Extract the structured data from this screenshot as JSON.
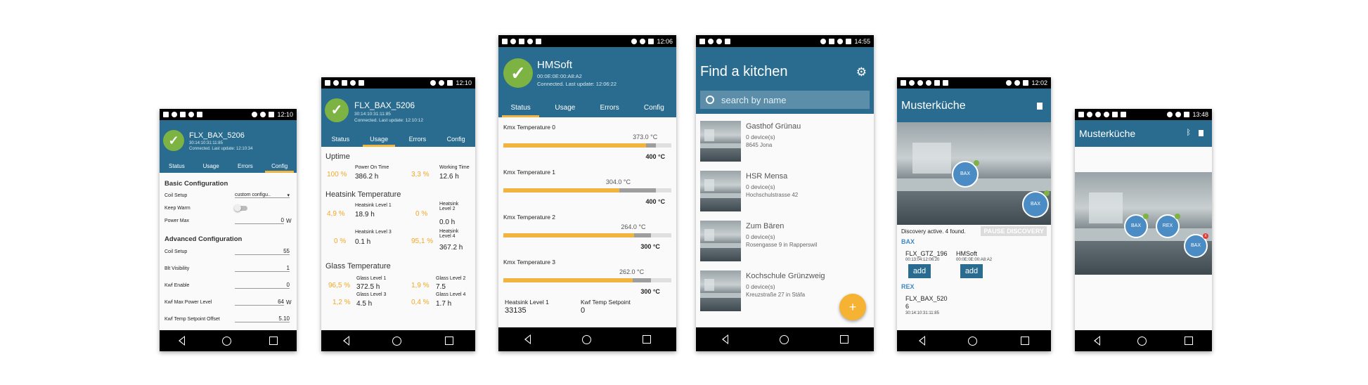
{
  "screens": {
    "s1": {
      "status_time": "12:10",
      "device_name": "FLX_BAX_5206",
      "device_mac": "30:14:10:31:11:85",
      "device_status": "Connected. Last update: 12:10:34",
      "tabs": [
        "Status",
        "Usage",
        "Errors",
        "Config"
      ],
      "basic_title": "Basic Configuration",
      "basic": [
        {
          "label": "Coil Setup",
          "value": "custom configu..",
          "kind": "dropdown"
        },
        {
          "label": "Keep Warm",
          "value": "",
          "kind": "toggle"
        },
        {
          "label": "Power Max",
          "value": "0",
          "unit": "W",
          "kind": "input"
        }
      ],
      "adv_title": "Advanced Configuration",
      "advanced": [
        {
          "label": "Coil Setup",
          "value": "55",
          "unit": ""
        },
        {
          "label": "Blt Visibility",
          "value": "1",
          "unit": ""
        },
        {
          "label": "Kwf Enable",
          "value": "0",
          "unit": ""
        },
        {
          "label": "Kwf Max Power Level",
          "value": "64",
          "unit": "W"
        },
        {
          "label": "Kwf Temp Setpoint Offset",
          "value": "5.10",
          "unit": ""
        }
      ]
    },
    "s2": {
      "status_time": "12:10",
      "device_name": "FLX_BAX_5206",
      "device_mac": "30:14:10:31:11:85",
      "device_status": "Connected. Last update: 12:10:12",
      "tabs": [
        "Status",
        "Usage",
        "Errors",
        "Config"
      ],
      "uptime_title": "Uptime",
      "uptime": [
        {
          "pct": "100 %",
          "label": "Power On Time",
          "value": "386.2 h"
        },
        {
          "pct": "3,3 %",
          "label": "Working Time",
          "value": "12.6 h"
        }
      ],
      "heatsink_title": "Heatsink Temperature",
      "heatsink": [
        {
          "pct": "4,9 %",
          "label": "Heatsink Level 1",
          "value": "18.9 h"
        },
        {
          "pct": "0 %",
          "label": "Heatsink Level 2",
          "value": "0.0 h"
        },
        {
          "pct": "0 %",
          "label": "Heatsink Level 3",
          "value": "0.1 h"
        },
        {
          "pct": "95,1 %",
          "label": "Heatsink Level 4",
          "value": "367.2 h"
        }
      ],
      "glass_title": "Glass Temperature",
      "glass": [
        {
          "pct": "96,5 %",
          "label": "Glass Level 1",
          "value": "372.5 h"
        },
        {
          "pct": "1,9 %",
          "label": "Glass Level 2",
          "value": "7.5"
        },
        {
          "pct": "1,2 %",
          "label": "Glass Level 3",
          "value": "4.5 h"
        },
        {
          "pct": "0,4 %",
          "label": "Glass Level 4",
          "value": "1.7 h"
        }
      ]
    },
    "s3": {
      "status_time": "12:06",
      "device_name": "HMSoft",
      "device_mac": "00:0E:0E:00:A8:A2",
      "device_status": "Connected. Last update: 12:06:22",
      "tabs": [
        "Status",
        "Usage",
        "Errors",
        "Config"
      ],
      "temps": [
        {
          "label": "Kmx Temperature 0",
          "current": "373.0 °C",
          "limit": "400 °C",
          "fill": 0.85,
          "grey_end": 0.91
        },
        {
          "label": "Kmx Temperature 1",
          "current": "304.0 °C",
          "limit": "400 °C",
          "fill": 0.69,
          "grey_end": 0.91
        },
        {
          "label": "Kmx Temperature 2",
          "current": "264.0 °C",
          "limit": "300 °C",
          "fill": 0.78,
          "grey_end": 0.88
        },
        {
          "label": "Kmx Temperature 3",
          "current": "262.0 °C",
          "limit": "300 °C",
          "fill": 0.77,
          "grey_end": 0.88
        }
      ],
      "footer_labels": [
        "Heatsink Level 1",
        "Kwf Temp Setpoint"
      ],
      "footer_values": [
        "33135",
        "0"
      ]
    },
    "s4": {
      "status_time": "14:55",
      "title": "Find a kitchen",
      "search_placeholder": "search by name",
      "fab_label": "+",
      "kitchens": [
        {
          "name": "Gasthof Grünau",
          "devices": "0 device(s)",
          "address": "8645 Jona"
        },
        {
          "name": "HSR Mensa",
          "devices": "0 device(s)",
          "address": "Hochschulstrasse 42"
        },
        {
          "name": "Zum Bären",
          "devices": "0 device(s)",
          "address": "Rosengasse 9 in Rapperswil"
        },
        {
          "name": "Kochschule Grünzweig",
          "devices": "0 device(s)",
          "address": "Kreuzstraße 27 in Stäfa"
        }
      ]
    },
    "s5": {
      "status_time": "12:02",
      "title": "Musterküche",
      "discovery_text": "Discovery active. 4 found.",
      "pause_label": "PAUSE DISCOVERY",
      "bax_title": "BAX",
      "bax_devices": [
        {
          "name": "FLX_GTZ_196",
          "mac": "00:13:04:12:06:20",
          "add": "add"
        },
        {
          "name": "HMSoft",
          "mac": "00:0E:0E:00:A8:A2",
          "add": "add"
        }
      ],
      "rex_title": "REX",
      "rex_device_name": "FLX_BAX_520\n6",
      "rex_device_mac": "30:14:10:31:11:85",
      "bubbles": [
        "BAX",
        "BAX"
      ]
    },
    "s6": {
      "status_time": "13:48",
      "title": "Musterküche",
      "bubbles": [
        "BAX",
        "REX",
        "BAX"
      ]
    }
  },
  "colors": {
    "primary": "#2a6c8f",
    "accent": "#f2b441",
    "check": "#7cb342"
  }
}
